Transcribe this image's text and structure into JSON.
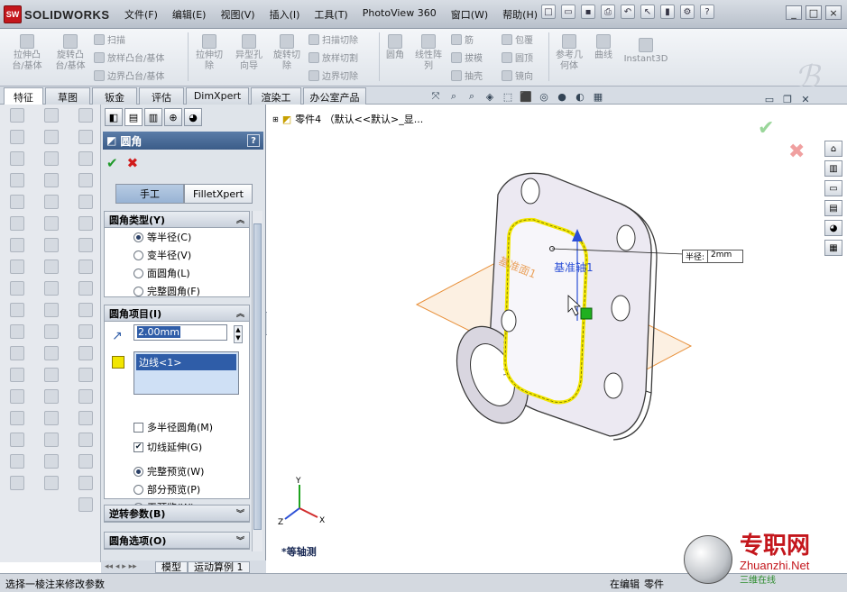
{
  "app": {
    "brand": "SOLIDWORKS",
    "brand_badge": "SW"
  },
  "menu": [
    "文件(F)",
    "编辑(E)",
    "视图(V)",
    "插入(I)",
    "工具(T)",
    "PhotoView 360",
    "窗口(W)",
    "帮助(H)"
  ],
  "title_tools": [
    "新建",
    "打开",
    "保存",
    "打印",
    "撤销",
    "选择",
    "重建",
    "选项",
    "帮助"
  ],
  "window_controls": [
    "_",
    "□",
    "×"
  ],
  "ribbon": {
    "large": [
      {
        "label1": "拉伸凸",
        "label2": "台/基体"
      },
      {
        "label1": "旋转凸",
        "label2": "台/基体"
      },
      {
        "label1": "拉伸切",
        "label2": "除"
      },
      {
        "label1": "异型孔",
        "label2": "向导"
      },
      {
        "label1": "旋转切",
        "label2": "除"
      },
      {
        "label1": "圆角",
        "label2": ""
      },
      {
        "label1": "线性阵",
        "label2": "列"
      },
      {
        "label1": "参考几",
        "label2": "何体"
      },
      {
        "label1": "曲线",
        "label2": ""
      },
      {
        "label1": "Instant3D",
        "label2": ""
      }
    ],
    "small": [
      "扫描",
      "放样凸台/基体",
      "边界凸台/基体",
      "扫描切除",
      "放样切割",
      "边界切除",
      "筋",
      "拔模",
      "抽壳",
      "包覆",
      "圆顶",
      "镜向"
    ]
  },
  "tabs": [
    "特征",
    "草图",
    "钣金",
    "评估",
    "DimXpert",
    "渲染工具",
    "办公室产品"
  ],
  "panel": {
    "title": "圆角",
    "help": "?",
    "modes": [
      "手工",
      "FilletXpert"
    ],
    "fillet_type": {
      "header": "圆角类型(Y)",
      "options": [
        "等半径(C)",
        "变半径(V)",
        "面圆角(L)",
        "完整圆角(F)"
      ],
      "selected": 0
    },
    "fillet_items": {
      "header": "圆角项目(I)",
      "radius": "2.00mm",
      "edges": [
        "边线<1>"
      ]
    },
    "checkboxes": [
      {
        "label": "多半径圆角(M)",
        "checked": false
      },
      {
        "label": "切线延伸(G)",
        "checked": true
      }
    ],
    "preview": {
      "options": [
        "完整预览(W)",
        "部分预览(P)",
        "无预览(W)"
      ],
      "selected": 0
    },
    "setback": "逆转参数(B)",
    "fillet_options": "圆角选项(O)"
  },
  "bottom_tabs": [
    "模型",
    "运动算例 1"
  ],
  "viewport": {
    "tree_label": "零件4 （默认<<默认>_显...",
    "plane_label": "基准面1",
    "axis_label": "基准轴1",
    "callout": {
      "label": "半径:",
      "value": "2mm"
    },
    "view_name": "*等轴测"
  },
  "status": {
    "left": "选择一棱注来修改参数",
    "mid": "在编辑",
    "right": "零件"
  },
  "watermark": {
    "title": "专职网",
    "url": "Zhuanzhi.Net",
    "sub": "三维在线"
  },
  "colors": {
    "ok": "#1f9a2a",
    "cancel": "#d11b1b",
    "highlight": "#f2e600",
    "plane": "#e8903a",
    "accent": "#2f5da8"
  }
}
